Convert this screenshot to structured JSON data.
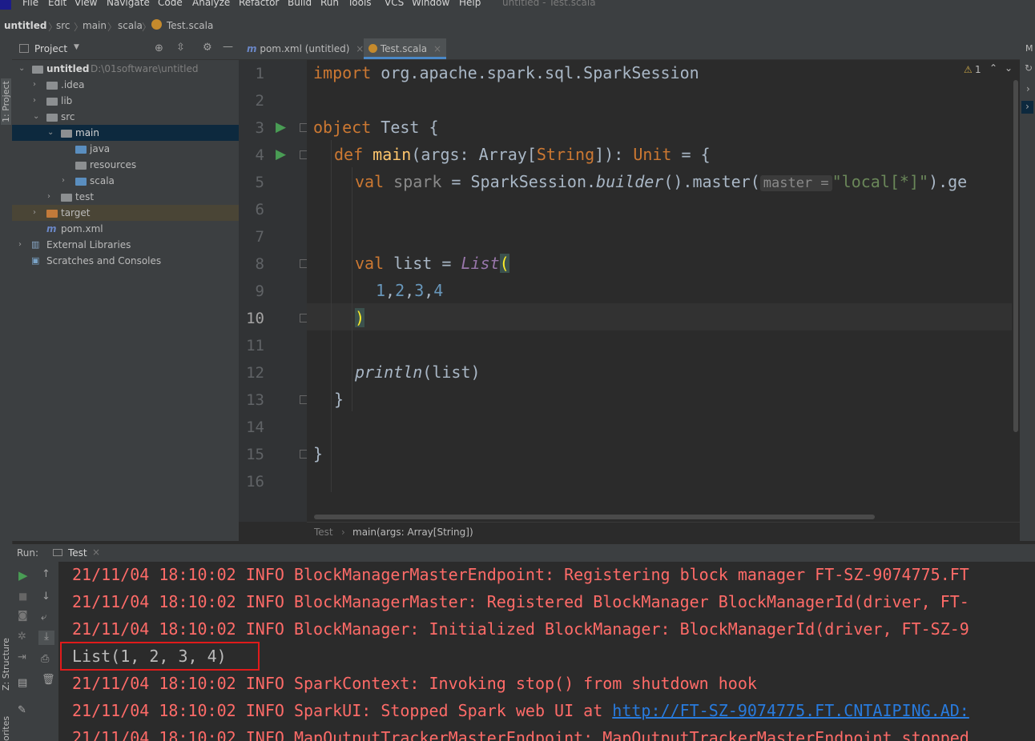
{
  "menu": {
    "items": [
      "File",
      "Edit",
      "View",
      "Navigate",
      "Code",
      "Analyze",
      "Refactor",
      "Build",
      "Run",
      "Tools",
      "VCS",
      "Window",
      "Help"
    ],
    "window_title": "untitled - Test.scala"
  },
  "breadcrumb": {
    "project": "untitled",
    "src": "src",
    "main": "main",
    "scala": "scala",
    "file": "Test.scala"
  },
  "stripes": {
    "project_tab": "1: Project",
    "structure_tab": "Z: Structure",
    "favorites_tab": "orites",
    "right_top": "M"
  },
  "project_panel": {
    "title": "Project",
    "tree": [
      {
        "label": "untitled",
        "path": "D:\\01software\\untitled"
      },
      {
        "label": ".idea"
      },
      {
        "label": "lib"
      },
      {
        "label": "src"
      },
      {
        "label": "main"
      },
      {
        "label": "java"
      },
      {
        "label": "resources"
      },
      {
        "label": "scala"
      },
      {
        "label": "test"
      },
      {
        "label": "target"
      },
      {
        "label": "pom.xml"
      },
      {
        "label": "External Libraries"
      },
      {
        "label": "Scratches and Consoles"
      }
    ]
  },
  "tabs": [
    {
      "label": "pom.xml (untitled)",
      "icon": "m"
    },
    {
      "label": "Test.scala",
      "active": true
    }
  ],
  "editor": {
    "line_numbers": [
      "1",
      "2",
      "3",
      "4",
      "5",
      "6",
      "7",
      "8",
      "9",
      "10",
      "11",
      "12",
      "13",
      "14",
      "15",
      "16"
    ],
    "current_line": "10",
    "inspection": "1",
    "code": {
      "l1_kw": "import",
      "l1_rest": " org.apache.spark.sql.SparkSession",
      "l3_kw": "object",
      "l3_rest": " Test {",
      "l4_kw": "def",
      "l4_fn": "main",
      "l4_a": "(args: Array[",
      "l4_ty": "String",
      "l4_b": "]): ",
      "l4_unit": "Unit",
      "l4_c": " = {",
      "l5_kw": "val",
      "l5_var": " spark",
      "l5_a": " = SparkSession.",
      "l5_builder": "builder",
      "l5_b": "().master(",
      "l5_hint": "master =",
      "l5_str": "\"local[*]\"",
      "l5_c": ").ge",
      "l8_kw": "val",
      "l8_a": " list = ",
      "l8_list": "List",
      "l8_paren": "(",
      "l9_nums": [
        "1",
        "2",
        "3",
        "4"
      ],
      "l10_paren": ")",
      "l12_fn": "println",
      "l12_rest": "(list)",
      "l13": "}",
      "l15": "}"
    },
    "breadcrumbs": [
      "Test",
      "main(args: Array[String])"
    ]
  },
  "run_panel": {
    "label": "Run:",
    "tab": "Test",
    "lines": [
      {
        "text": "21/11/04 18:10:02 INFO BlockManagerMasterEndpoint: Registering block manager FT-SZ-9074775.FT",
        "type": "stderr"
      },
      {
        "text": "21/11/04 18:10:02 INFO BlockManagerMaster: Registered BlockManager BlockManagerId(driver, FT-",
        "type": "stderr"
      },
      {
        "text": "21/11/04 18:10:02 INFO BlockManager: Initialized BlockManager: BlockManagerId(driver, FT-SZ-9",
        "type": "stderr"
      },
      {
        "text": "List(1, 2, 3, 4)",
        "type": "stdout"
      },
      {
        "text": "21/11/04 18:10:02 INFO SparkContext: Invoking stop() from shutdown hook",
        "type": "stderr"
      },
      {
        "text_prefix": "21/11/04 18:10:02 INFO SparkUI: Stopped Spark web UI at ",
        "link": "http://FT-SZ-9074775.FT.CNTAIPING.AD:",
        "type": "stderr"
      },
      {
        "text": "21/11/04 18:10:02 INFO MapOutputTrackerMasterEndpoint: MapOutputTrackerMasterEndpoint stopped",
        "type": "stderr"
      }
    ]
  },
  "colors": {
    "stderr": "#ff6b68",
    "highlight_box": "#e01b1b",
    "keyword": "#cc7832",
    "function": "#ffc66d"
  }
}
